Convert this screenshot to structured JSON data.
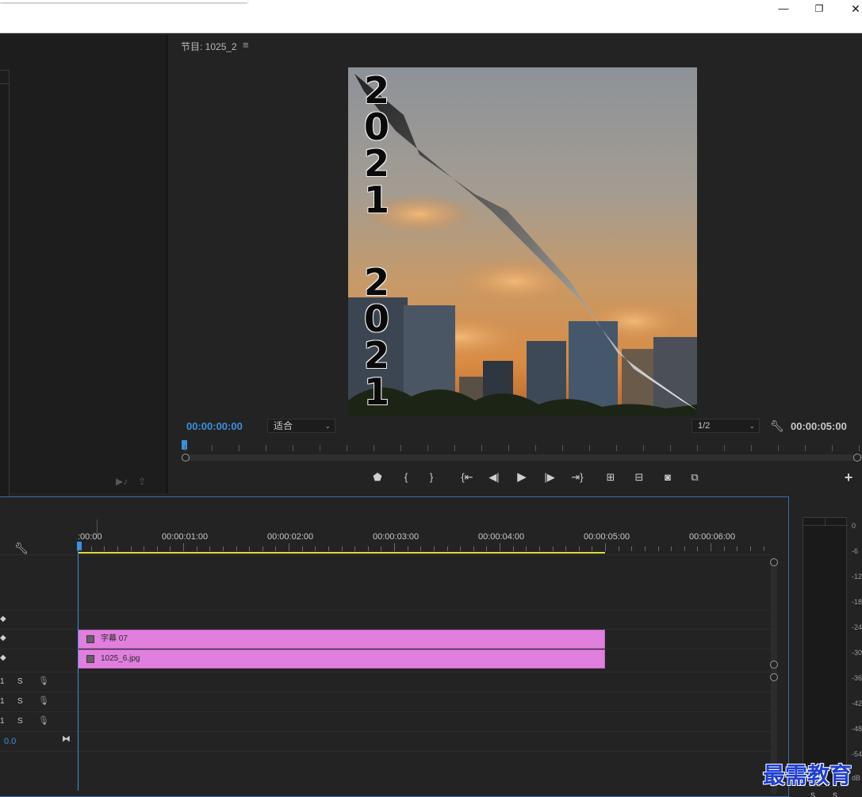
{
  "window": {
    "min_glyph": "—",
    "max_glyph": "❐",
    "close_glyph": "✕"
  },
  "program_monitor": {
    "tab_label": "节目: 1025_2",
    "menu_glyph": "≡",
    "timecode_current": "00:00:00:00",
    "fit_value": "适合",
    "resolution_value": "1/2",
    "timecode_duration": "00:00:05:00",
    "frame_text": {
      "top_digits": [
        "2",
        "0",
        "2",
        "1"
      ],
      "bottom_digits": [
        "2",
        "0",
        "2",
        "1"
      ]
    },
    "transport_icons": [
      "marker-icon",
      "mark-in-icon",
      "mark-out-icon",
      "go-to-in-icon",
      "step-back-icon",
      "play-icon",
      "step-forward-icon",
      "go-to-out-icon",
      "lift-icon",
      "extract-icon",
      "export-frame-icon",
      "compare-icon",
      "add-button-icon"
    ]
  },
  "timeline": {
    "ruler_labels": [
      ":00:00",
      "00:00:01:00",
      "00:00:02:00",
      "00:00:03:00",
      "00:00:04:00",
      "00:00:05:00",
      "00:00:06:00"
    ],
    "clips": [
      {
        "name": "字幕 07",
        "color": "#e07fde"
      },
      {
        "name": "1025_6.jpg",
        "color": "#e07fde"
      }
    ],
    "audio_tracks": [
      {
        "m": "1",
        "s": "S"
      },
      {
        "m": "1",
        "s": "S"
      },
      {
        "m": "1",
        "s": "S"
      }
    ],
    "master_value": "0.0"
  },
  "audio_meter": {
    "db_labels": [
      "0",
      "-6",
      "-12",
      "-18",
      "-24",
      "-30",
      "-36",
      "-42",
      "-48",
      "-54",
      "dB"
    ],
    "solo_labels": [
      "S",
      "S"
    ]
  },
  "watermark": "最需教育",
  "colors": {
    "accent_blue": "#3d8fe0",
    "clip_pink": "#e07fde",
    "work_area_yellow": "#e4d83b",
    "panel_bg": "#232323"
  }
}
